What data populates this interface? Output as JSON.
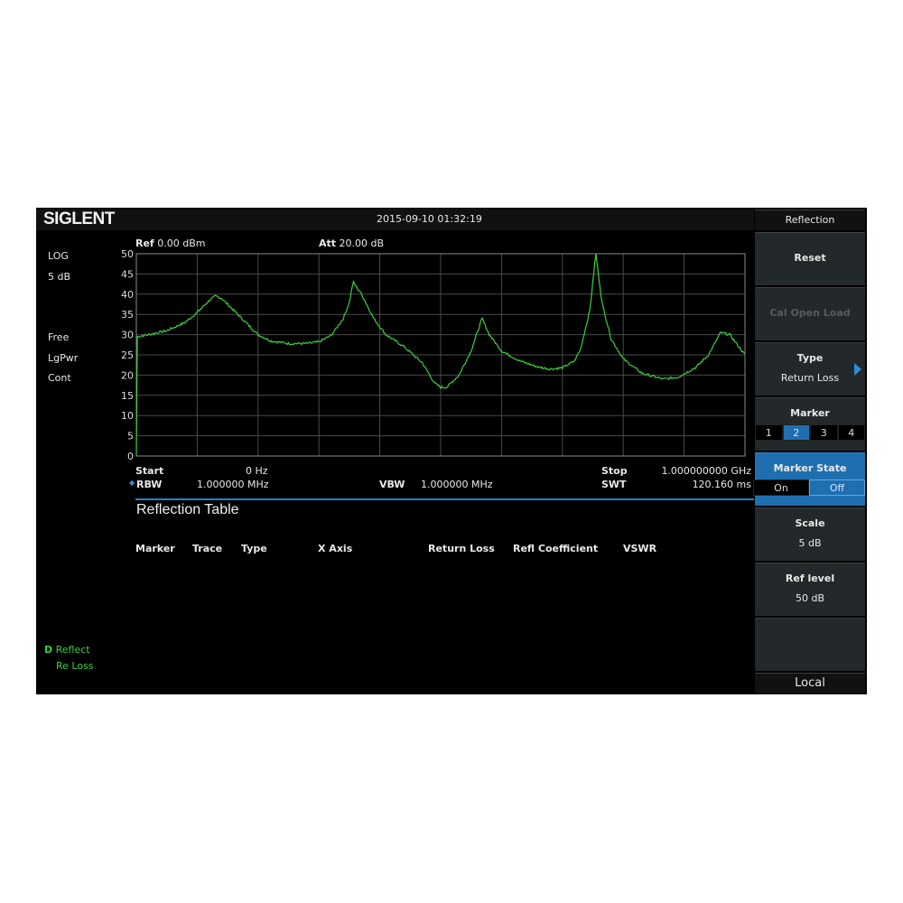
{
  "header": {
    "brand": "SIGLENT",
    "datetime": "2015-09-10   01:32:19"
  },
  "left_panel": {
    "scale_type": "LOG",
    "scale_div": "5  dB",
    "trigger": "Free",
    "detector": "LgPwr",
    "sweep_mode": "Cont",
    "trace_mode": "D",
    "trace_label": "Reflect",
    "trace_type": "Re Loss"
  },
  "plot_header": {
    "ref_label": "Ref",
    "ref_value": "0.00 dBm",
    "att_label": "Att",
    "att_value": "20.00 dB"
  },
  "footer": {
    "start_label": "Start",
    "start_value": "0   Hz",
    "stop_label": "Stop",
    "stop_value": "1.000000000  GHz",
    "rbw_label": "RBW",
    "rbw_value": "1.000000  MHz",
    "vbw_label": "VBW",
    "vbw_value": "1.000000  MHz",
    "swt_label": "SWT",
    "swt_value": "120.160 ms"
  },
  "table": {
    "title": "Reflection Table",
    "columns": [
      "Marker",
      "Trace",
      "Type",
      "X Axis",
      "Return Loss",
      "Refl Coefficient",
      "VSWR"
    ]
  },
  "softkeys": {
    "title": "Reflection",
    "reset": "Reset",
    "cal": "Cal Open Load",
    "type_label": "Type",
    "type_value": "Return Loss",
    "marker_label": "Marker",
    "markers": [
      "1",
      "2",
      "3",
      "4"
    ],
    "marker_selected": "2",
    "marker_state_label": "Marker State",
    "state_on": "On",
    "state_off": "Off",
    "state_selected": "Off",
    "scale_label": "Scale",
    "scale_value": "5 dB",
    "ref_level_label": "Ref level",
    "ref_level_value": "50 dB",
    "local": "Local"
  },
  "colors": {
    "trace": "#3ad13a",
    "accent": "#1f6fb0",
    "grid": "#4a4a4a"
  },
  "chart_data": {
    "type": "line",
    "xlim": [
      0,
      1.0
    ],
    "x_unit": "GHz",
    "ylim": [
      0,
      50
    ],
    "yticks": [
      "50",
      "45",
      "40",
      "35",
      "30",
      "25",
      "20",
      "15",
      "10",
      "5",
      "0"
    ],
    "grid": true,
    "x": [
      0,
      0.001,
      0.02,
      0.05,
      0.08,
      0.1,
      0.12,
      0.13,
      0.14,
      0.16,
      0.18,
      0.2,
      0.22,
      0.25,
      0.28,
      0.3,
      0.32,
      0.34,
      0.35,
      0.356,
      0.37,
      0.39,
      0.41,
      0.44,
      0.47,
      0.49,
      0.5,
      0.51,
      0.53,
      0.55,
      0.568,
      0.58,
      0.6,
      0.63,
      0.66,
      0.68,
      0.7,
      0.72,
      0.73,
      0.745,
      0.755,
      0.765,
      0.78,
      0.8,
      0.83,
      0.866,
      0.89,
      0.92,
      0.94,
      0.96,
      0.975,
      1.0
    ],
    "values": [
      0,
      29.5,
      30,
      31,
      33,
      35.5,
      38.5,
      39.5,
      39,
      36,
      33,
      30,
      28.5,
      27.8,
      27.8,
      28.2,
      29.8,
      34,
      38,
      43,
      40,
      34,
      30,
      27,
      23,
      18,
      17,
      17,
      20,
      26,
      34,
      30,
      26,
      23.5,
      22,
      21.5,
      21.8,
      23.5,
      26.5,
      36,
      50,
      38,
      29,
      24,
      20.5,
      19,
      19.5,
      22,
      25,
      30.5,
      30,
      25
    ]
  }
}
